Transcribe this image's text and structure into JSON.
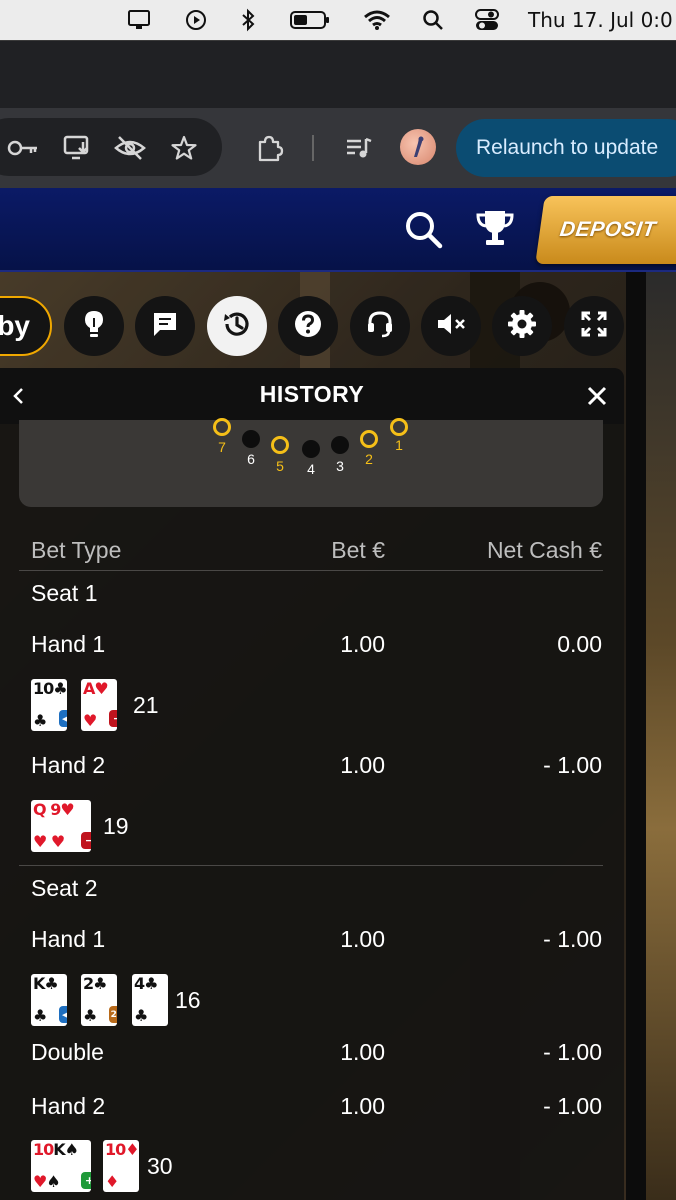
{
  "menubar": {
    "clock": "Thu 17. Jul  0:0",
    "icons": [
      "display-icon",
      "play-circle-icon",
      "bluetooth-icon",
      "battery-icon",
      "wifi-icon",
      "search-icon",
      "control-center-icon"
    ]
  },
  "browser": {
    "relaunch_label": "Relaunch to update",
    "toolbar_icons": [
      "key-icon",
      "install-app-icon",
      "eye-slash-icon",
      "star-icon",
      "extensions-icon",
      "media-queue-icon",
      "profile-avatar-icon"
    ]
  },
  "site": {
    "deposit_label": "DEPOSIT",
    "header_icons": [
      "search-icon",
      "trophy-icon"
    ]
  },
  "controls": {
    "lobby_fragment": "by",
    "buttons": [
      "lightbulb-icon",
      "chat-icon",
      "history-icon",
      "help-icon",
      "headset-icon",
      "mute-icon",
      "settings-icon",
      "fullscreen-icon"
    ],
    "active": "history-icon"
  },
  "history": {
    "title": "HISTORY",
    "seats_indicator": [
      {
        "n": "7",
        "state": "gold"
      },
      {
        "n": "6",
        "state": "dark"
      },
      {
        "n": "5",
        "state": "gold"
      },
      {
        "n": "4",
        "state": "dark"
      },
      {
        "n": "3",
        "state": "dark"
      },
      {
        "n": "2",
        "state": "gold"
      },
      {
        "n": "1",
        "state": "gold"
      }
    ],
    "columns": {
      "bet_type": "Bet Type",
      "bet": "Bet €",
      "net": "Net Cash €"
    },
    "seat1": {
      "label": "Seat 1",
      "hand1": {
        "label": "Hand 1",
        "bet": "1.00",
        "net": "0.00",
        "total": "21",
        "cards": [
          {
            "rank": "10",
            "suit": "♣",
            "color": "black",
            "badge": "split"
          },
          {
            "rank": "A",
            "suit": "♥",
            "color": "red",
            "badge": "minus"
          }
        ]
      },
      "hand2": {
        "label": "Hand 2",
        "bet": "1.00",
        "net": "- 1.00",
        "total": "19",
        "cards": [
          {
            "rank": "Q",
            "suit": "♥",
            "color": "red"
          },
          {
            "rank": "9",
            "suit": "♥",
            "color": "red",
            "badge": "minus"
          }
        ]
      }
    },
    "seat2": {
      "label": "Seat 2",
      "hand1": {
        "label": "Hand 1",
        "bet": "1.00",
        "net": "- 1.00",
        "total": "16",
        "cards": [
          {
            "rank": "K",
            "suit": "♣",
            "color": "black",
            "badge": "split"
          },
          {
            "rank": "2",
            "suit": "♣",
            "color": "black",
            "badge": "double"
          },
          {
            "rank": "4",
            "suit": "♣",
            "color": "black"
          }
        ]
      },
      "double": {
        "label": "Double",
        "bet": "1.00",
        "net": "- 1.00"
      },
      "hand2": {
        "label": "Hand 2",
        "bet": "1.00",
        "net": "- 1.00",
        "total": "30",
        "cards": [
          {
            "rank": "10",
            "suit": "♥",
            "color": "red"
          },
          {
            "rank": "K",
            "suit": "♠",
            "color": "black",
            "badge": "plus"
          },
          {
            "rank": "10",
            "suit": "♦",
            "color": "red"
          }
        ]
      }
    },
    "badges": {
      "split": "◂▸",
      "minus": "−",
      "double": "2×",
      "plus": "+"
    }
  }
}
